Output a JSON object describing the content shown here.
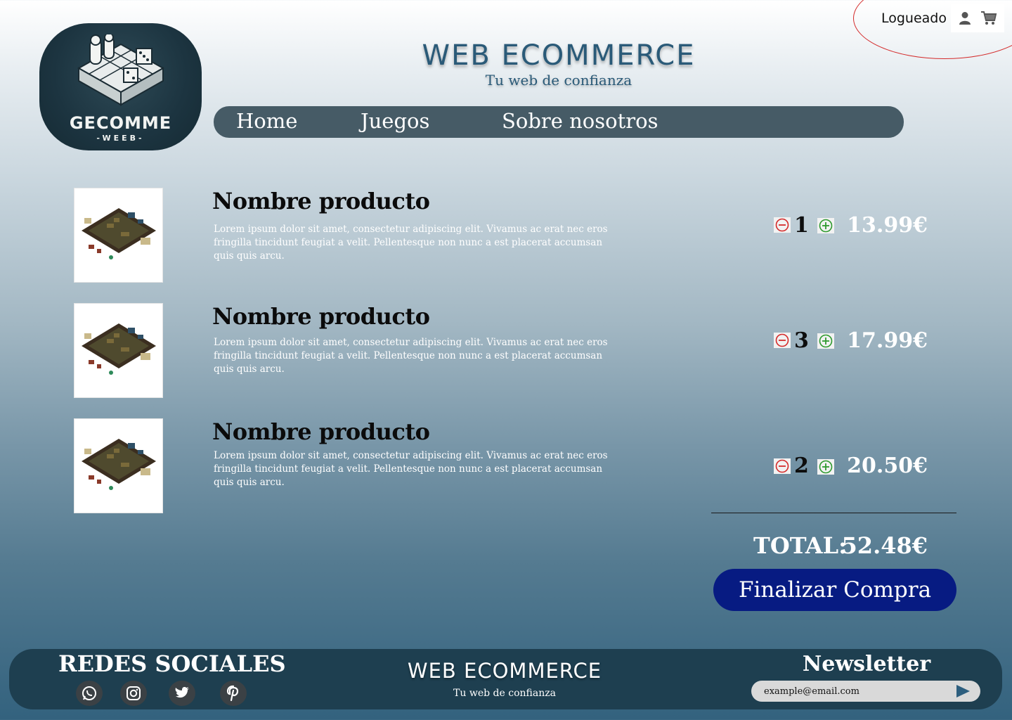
{
  "header": {
    "login_label": "Logueado",
    "logo_name": "GECOMME",
    "logo_sub": "-WEEB-",
    "title": "WEB ECOMMERCE",
    "tagline": "Tu web de confianza",
    "nav": [
      {
        "label": "Home"
      },
      {
        "label": "Juegos"
      },
      {
        "label": "Sobre nosotros"
      }
    ]
  },
  "cart": {
    "items": [
      {
        "name": "Nombre producto",
        "description": "Lorem ipsum dolor sit amet, consectetur adipiscing elit. Vivamus ac erat nec eros fringilla tincidunt feugiat a velit. Pellentesque non nunc a est placerat accumsan quis quis arcu.",
        "quantity": "1",
        "price": "13.99€"
      },
      {
        "name": "Nombre producto",
        "description": "Lorem ipsum dolor sit amet, consectetur adipiscing elit. Vivamus ac erat nec eros fringilla tincidunt feugiat a velit. Pellentesque non nunc a est placerat accumsan quis quis arcu.",
        "quantity": "3",
        "price": "17.99€"
      },
      {
        "name": "Nombre producto",
        "description": "Lorem ipsum dolor sit amet, consectetur adipiscing elit. Vivamus ac erat nec eros fringilla tincidunt feugiat a velit. Pellentesque non nunc a est placerat accumsan quis quis arcu.",
        "quantity": "2",
        "price": "20.50€"
      }
    ],
    "total_label": "TOTAL:",
    "total_value": "52.48€",
    "checkout_label": "Finalizar Compra"
  },
  "footer": {
    "social_title": "REDES SOCIALES",
    "social_icons": [
      "whatsapp-icon",
      "instagram-icon",
      "twitter-icon",
      "pinterest-icon"
    ],
    "title": "WEB ECOMMERCE",
    "tagline": "Tu web de confianza",
    "newsletter_title": "Newsletter",
    "newsletter_placeholder": "example@email.com"
  },
  "colors": {
    "nav_bg": "#465b66",
    "checkout_bg": "#071b82",
    "footer_bg": "#1e3f50",
    "minus": "#d42b2b",
    "plus": "#2e9a2e"
  }
}
